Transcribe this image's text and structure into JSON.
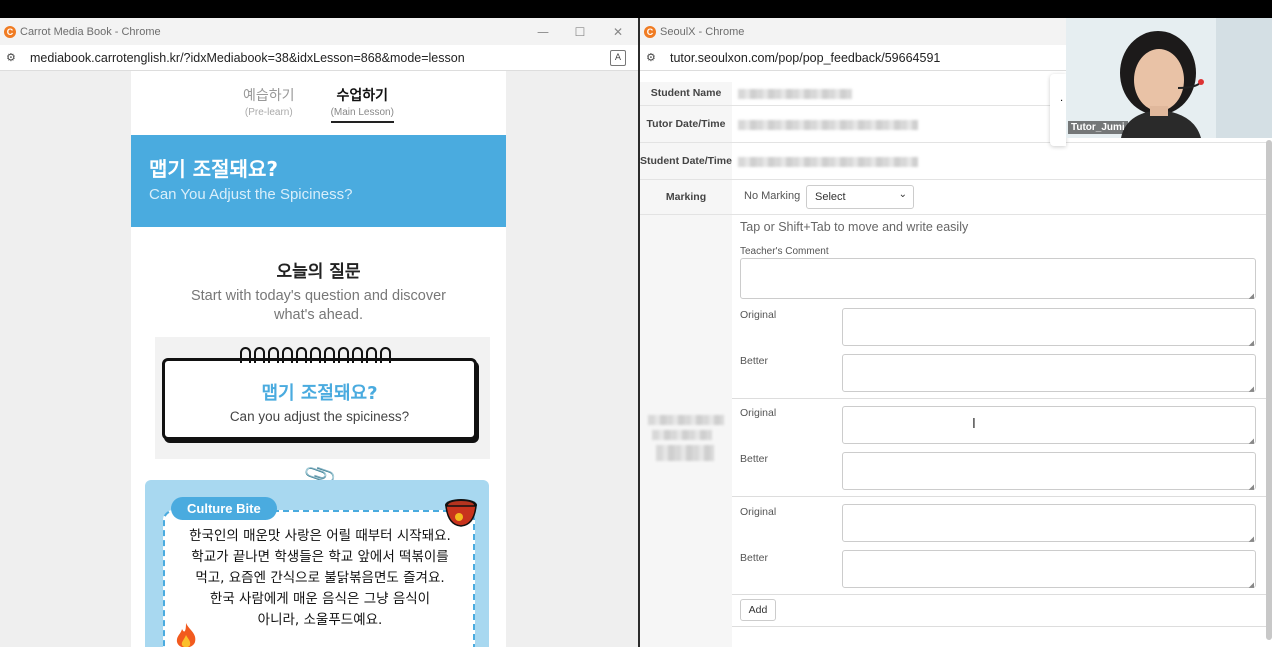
{
  "left_window": {
    "title": "Carrot Media Book - Chrome",
    "url": "mediabook.carrotenglish.kr/?idxMediabook=38&idxLesson=868&mode=lesson",
    "tabs": [
      {
        "ko": "예습하기",
        "en": "(Pre-learn)"
      },
      {
        "ko": "수업하기",
        "en": "(Main Lesson)"
      }
    ],
    "hero": {
      "ko": "맵기 조절돼요?",
      "en": "Can You Adjust the Spiciness?"
    },
    "question": {
      "title": "오늘의 질문",
      "subtitle": "Start with today's question and discover what's ahead.",
      "card_ko": "맵기 조절돼요?",
      "card_en": "Can you adjust the spiciness?"
    },
    "culture": {
      "badge": "Culture Bite",
      "lines": [
        "한국인의 매운맛 사랑은 어릴 때부터 시작돼요.",
        "학교가 끝나면 학생들은 학교 앞에서 떡볶이를",
        "먹고, 요즘엔 간식으로 불닭볶음면도 즐겨요.",
        "한국 사람에게 매운 음식은 그냥 음식이",
        "아니라, 소울푸드예요."
      ]
    }
  },
  "right_window": {
    "title": "SeoulX - Chrome",
    "url": "tutor.seoulxon.com/pop/pop_feedback/59664591",
    "labels": {
      "student_name": "Student Name",
      "tutor_dt": "Tutor Date/Time",
      "student_dt": "Student Date/Time",
      "marking": "Marking"
    },
    "no_marking": "No Marking",
    "select_value": "Select",
    "hint": "Tap or Shift+Tab to move and write easily",
    "teacher_comment": "Teacher's Comment",
    "original": "Original",
    "better": "Better",
    "add": "Add"
  },
  "video": {
    "name": "Tutor_Jumi"
  }
}
